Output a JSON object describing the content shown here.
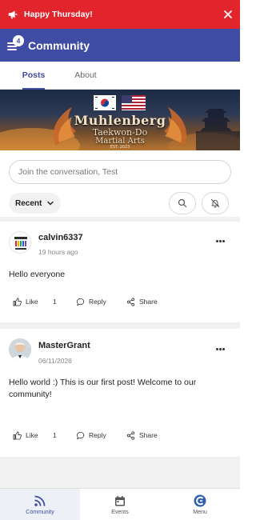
{
  "banner": {
    "text": "Happy Thursday!",
    "bg_color": "#e2242c"
  },
  "appbar": {
    "title": "Community",
    "notification_count": "4",
    "bg_color": "#3e4ca3"
  },
  "tabs": [
    {
      "label": "Posts",
      "active": true
    },
    {
      "label": "About",
      "active": false
    }
  ],
  "hero": {
    "school_line1": "Muhlenberg",
    "school_line2": "Taekwon-Do",
    "school_line3": "Martial Arts",
    "est": "EST. 2023"
  },
  "composer": {
    "placeholder": "Join the conversation, Test"
  },
  "filter": {
    "sort_label": "Recent"
  },
  "posts": [
    {
      "username": "calvin6337",
      "time": "19 hours ago",
      "body": "Hello everyone",
      "like_label": "Like",
      "like_count": "1",
      "reply_label": "Reply",
      "share_label": "Share"
    },
    {
      "username": "MasterGrant",
      "time": "06/11/2026",
      "body": "Hello world :) This is our first post! Welcome to our community!",
      "like_label": "Like",
      "like_count": "1",
      "reply_label": "Reply",
      "share_label": "Share"
    }
  ],
  "bottom_nav": [
    {
      "label": "Community",
      "icon": "rss-icon",
      "active": true
    },
    {
      "label": "Events",
      "icon": "calendar-icon",
      "active": false
    },
    {
      "label": "Menu",
      "icon": "brand-logo-icon",
      "active": false
    }
  ],
  "accent_color": "#3e4ca3"
}
